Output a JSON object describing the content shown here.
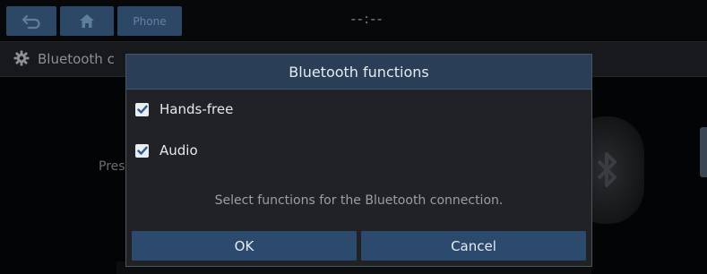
{
  "topbar": {
    "back_icon": "back-arrow-icon",
    "home_icon": "home-icon",
    "mode_label": "Phone",
    "clock": "--:--"
  },
  "subbar": {
    "icon": "gear-icon",
    "title": "Bluetooth c"
  },
  "background": {
    "partial_text": "Pres",
    "logo_icon": "bluetooth-icon"
  },
  "dialog": {
    "title": "Bluetooth functions",
    "options": [
      {
        "label": "Hands-free",
        "checked": true
      },
      {
        "label": "Audio",
        "checked": true
      }
    ],
    "info": "Select functions for the Bluetooth connection.",
    "ok_label": "OK",
    "cancel_label": "Cancel"
  },
  "colors": {
    "accent": "#2c4a6d",
    "header": "#2a3f57",
    "dialog_bg": "#202226",
    "checkbox": "#e9eef3",
    "check_mark": "#2f5b8f"
  }
}
